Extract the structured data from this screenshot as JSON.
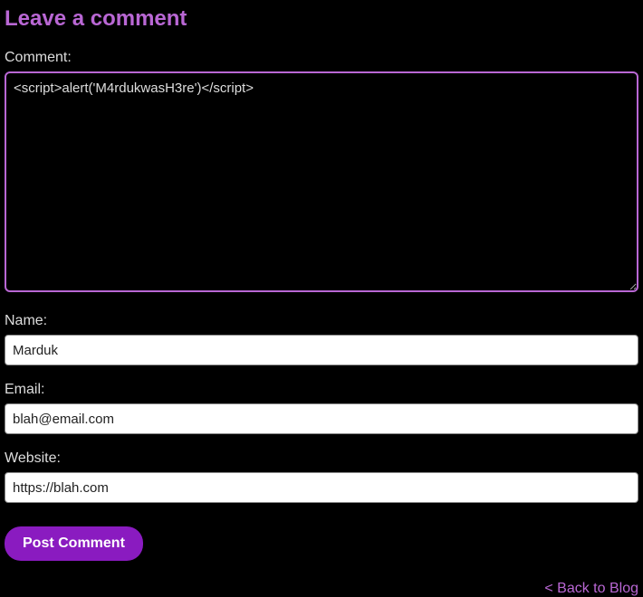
{
  "heading": "Leave a comment",
  "fields": {
    "comment": {
      "label": "Comment:",
      "value": "<script>alert('M4rdukwasH3re')</script>"
    },
    "name": {
      "label": "Name:",
      "value": "Marduk"
    },
    "email": {
      "label": "Email:",
      "value": "blah@email.com"
    },
    "website": {
      "label": "Website:",
      "value": "https://blah.com"
    }
  },
  "submit_label": "Post Comment",
  "back_link": "< Back to Blog"
}
